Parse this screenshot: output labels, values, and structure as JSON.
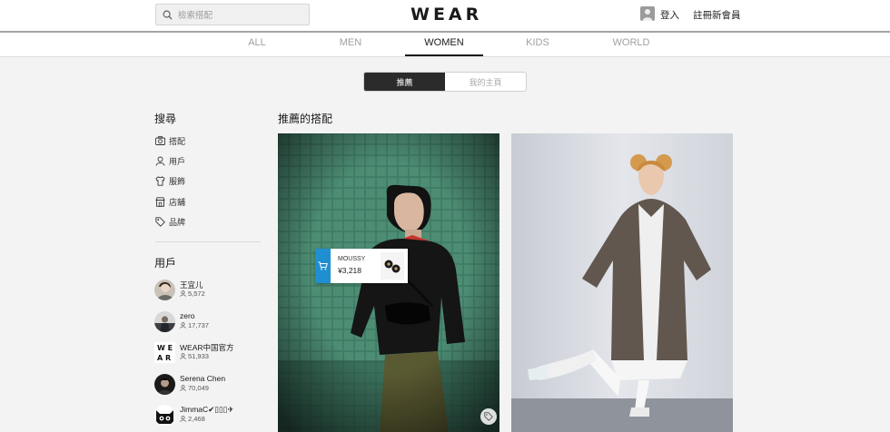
{
  "header": {
    "search_placeholder": "檢索搭配",
    "logo": "WEAR",
    "login": "登入",
    "signup": "註冊新會員"
  },
  "tabs": [
    {
      "label": "ALL",
      "active": false
    },
    {
      "label": "MEN",
      "active": false
    },
    {
      "label": "WOMEN",
      "active": true
    },
    {
      "label": "KIDS",
      "active": false
    },
    {
      "label": "WORLD",
      "active": false
    }
  ],
  "segment": {
    "recommended": "推薦",
    "my_page": "我的主頁"
  },
  "sidebar": {
    "search_heading": "搜尋",
    "search_links": [
      {
        "label": "搭配",
        "icon": "camera-icon"
      },
      {
        "label": "用戶",
        "icon": "user-icon"
      },
      {
        "label": "服飾",
        "icon": "shirt-icon"
      },
      {
        "label": "店舖",
        "icon": "shop-icon"
      },
      {
        "label": "品牌",
        "icon": "tag-icon"
      }
    ],
    "users_heading": "用戶",
    "users": [
      {
        "name": "王宜儿",
        "followers": "5,572"
      },
      {
        "name": "zero",
        "followers": "17,737"
      },
      {
        "name": "WEAR中国官方",
        "followers": "51,933"
      },
      {
        "name": "Serena Chen",
        "followers": "70,049"
      },
      {
        "name": "JimmaC✔︎▯▯▯✈︎",
        "followers": "2,468"
      }
    ]
  },
  "main": {
    "heading": "推薦的搭配",
    "item_tag": {
      "brand": "MOUSSY",
      "price": "¥3,218"
    }
  },
  "colors": {
    "accent_blue": "#1f8fd1",
    "dark": "#2b2b2b"
  }
}
